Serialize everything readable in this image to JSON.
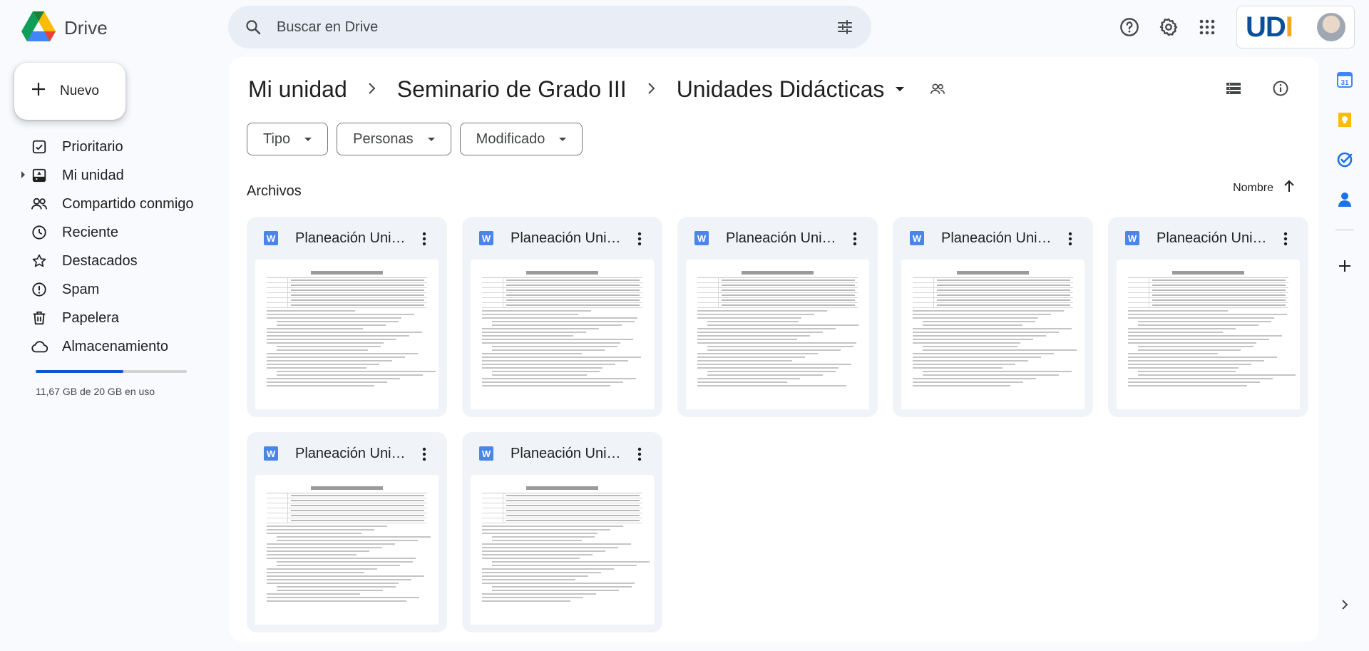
{
  "app": {
    "name": "Drive"
  },
  "search": {
    "placeholder": "Buscar en Drive"
  },
  "account": {
    "logo_text": "UD",
    "logo_accent": "I"
  },
  "new_button": {
    "label": "Nuevo"
  },
  "sidebar": {
    "items": [
      {
        "label": "Prioritario",
        "icon": "priority-icon"
      },
      {
        "label": "Mi unidad",
        "icon": "my-drive-icon"
      },
      {
        "label": "Compartido conmigo",
        "icon": "shared-icon"
      },
      {
        "label": "Reciente",
        "icon": "clock-icon"
      },
      {
        "label": "Destacados",
        "icon": "star-icon"
      },
      {
        "label": "Spam",
        "icon": "spam-icon"
      },
      {
        "label": "Papelera",
        "icon": "trash-icon"
      },
      {
        "label": "Almacenamiento",
        "icon": "cloud-icon"
      }
    ],
    "storage": {
      "text": "11,67 GB de 20 GB en uso",
      "used_fraction": 0.58
    }
  },
  "breadcrumb": [
    "Mi unidad",
    "Seminario de Grado III",
    "Unidades Didácticas"
  ],
  "filters": [
    "Tipo",
    "Personas",
    "Modificado"
  ],
  "section": {
    "title": "Archivos",
    "sort_label": "Nombre"
  },
  "files": [
    {
      "name": "Planeación Unidad Didáctica"
    },
    {
      "name": "Planeación Unidad Didáctica"
    },
    {
      "name": "Planeación Unidad Didáctica"
    },
    {
      "name": "Planeación Unidad Didáctica"
    },
    {
      "name": "Planeación Unidad Didáctica"
    },
    {
      "name": "Planeación Unidad Didáctica"
    },
    {
      "name": "Planeación Unidad Didáctica"
    }
  ],
  "colors": {
    "accent": "#0b57d0",
    "panel": "#ffffff",
    "background": "#f8fafd",
    "word": "#4a86e8"
  }
}
